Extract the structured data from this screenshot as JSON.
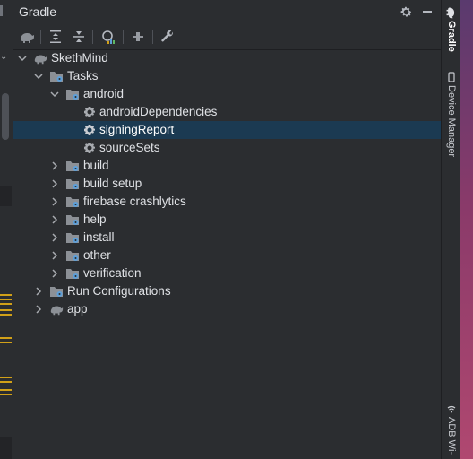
{
  "panel": {
    "title": "Gradle"
  },
  "toolbar": {
    "buttons": [
      "gradle-elephant",
      "expand-all",
      "collapse-all",
      "analyze-dependencies",
      "toggle-offline",
      "build-tool-settings"
    ]
  },
  "tree": {
    "project": "SkethMind",
    "tasks": "Tasks",
    "android": "android",
    "android_items": [
      "androidDependencies",
      "signingReport",
      "sourceSets"
    ],
    "groups": [
      "build",
      "build setup",
      "firebase crashlytics",
      "help",
      "install",
      "other",
      "verification"
    ],
    "run_configurations": "Run Configurations",
    "app": "app",
    "selected": "signingReport"
  },
  "right_sidebar": {
    "gradle_tab": "Gradle",
    "device_manager_tab": "Device Manager",
    "adb_tab": "ADB Wi-"
  },
  "colors": {
    "background": "#2b2d30",
    "selection": "#1b3a52",
    "gear_blue": "#5e9fd8",
    "folder": "#8c9096",
    "text": "#dfe1e5"
  }
}
